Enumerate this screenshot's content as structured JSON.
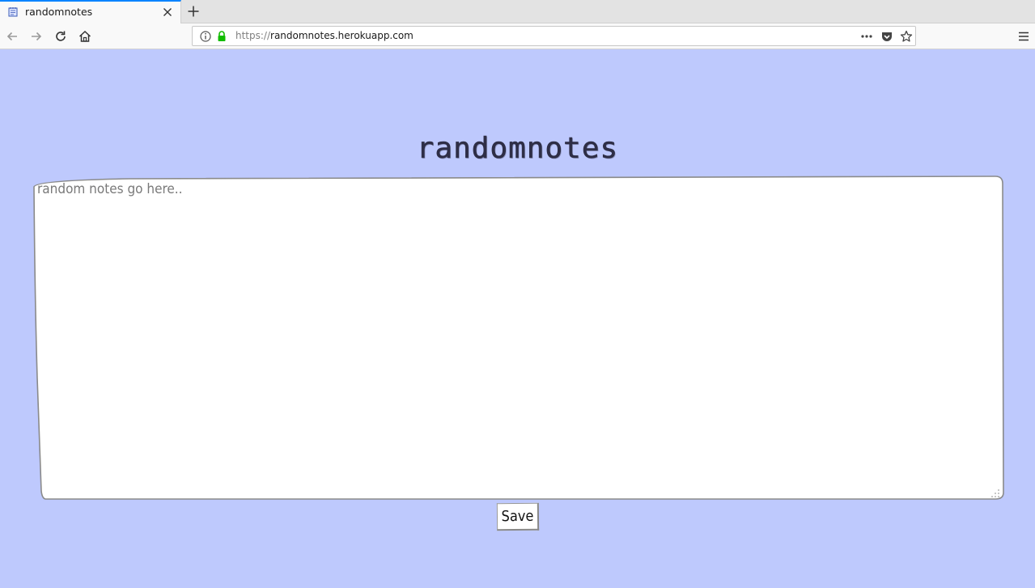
{
  "browser": {
    "tab": {
      "title": "randomnotes",
      "favicon": "notepad-icon"
    },
    "url": {
      "scheme": "https://",
      "host": "randomnotes.herokuapp.com"
    }
  },
  "page": {
    "title": "randomnotes",
    "notes": {
      "value": "",
      "placeholder": "random notes go here.."
    },
    "save_label": "Save"
  },
  "colors": {
    "page_background": "#bec9fd",
    "tab_accent": "#0a84ff",
    "lock_green": "#12bc00",
    "title_ink": "#2e2e46"
  }
}
